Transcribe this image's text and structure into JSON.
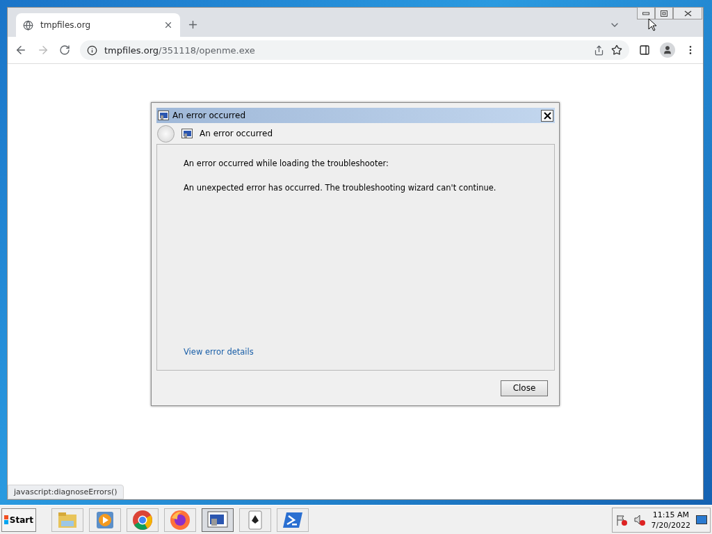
{
  "browser": {
    "tabs": [
      {
        "title": "tmpfiles.org",
        "selected": true
      }
    ],
    "url_host": "tmpfiles.org",
    "url_path": "/351118/openme.exe",
    "status_text": "javascript:diagnoseErrors()"
  },
  "dialog": {
    "title": "An error occurred",
    "header": "An error occurred",
    "message_lines": [
      "An error occurred while loading the troubleshooter:",
      "An unexpected error has occurred. The troubleshooting wizard can't continue."
    ],
    "link": "View error details",
    "buttons": [
      "Close"
    ]
  },
  "taskbar": {
    "start": "Start",
    "apps": [
      {
        "kind": "folder",
        "selected": false
      },
      {
        "kind": "media",
        "selected": false
      },
      {
        "kind": "chrome",
        "selected": false
      },
      {
        "kind": "firefox",
        "selected": false
      },
      {
        "kind": "window",
        "selected": true
      },
      {
        "kind": "cards",
        "selected": false
      },
      {
        "kind": "shell",
        "selected": false
      }
    ],
    "time": "11:15 AM",
    "date": "7/20/2022"
  }
}
